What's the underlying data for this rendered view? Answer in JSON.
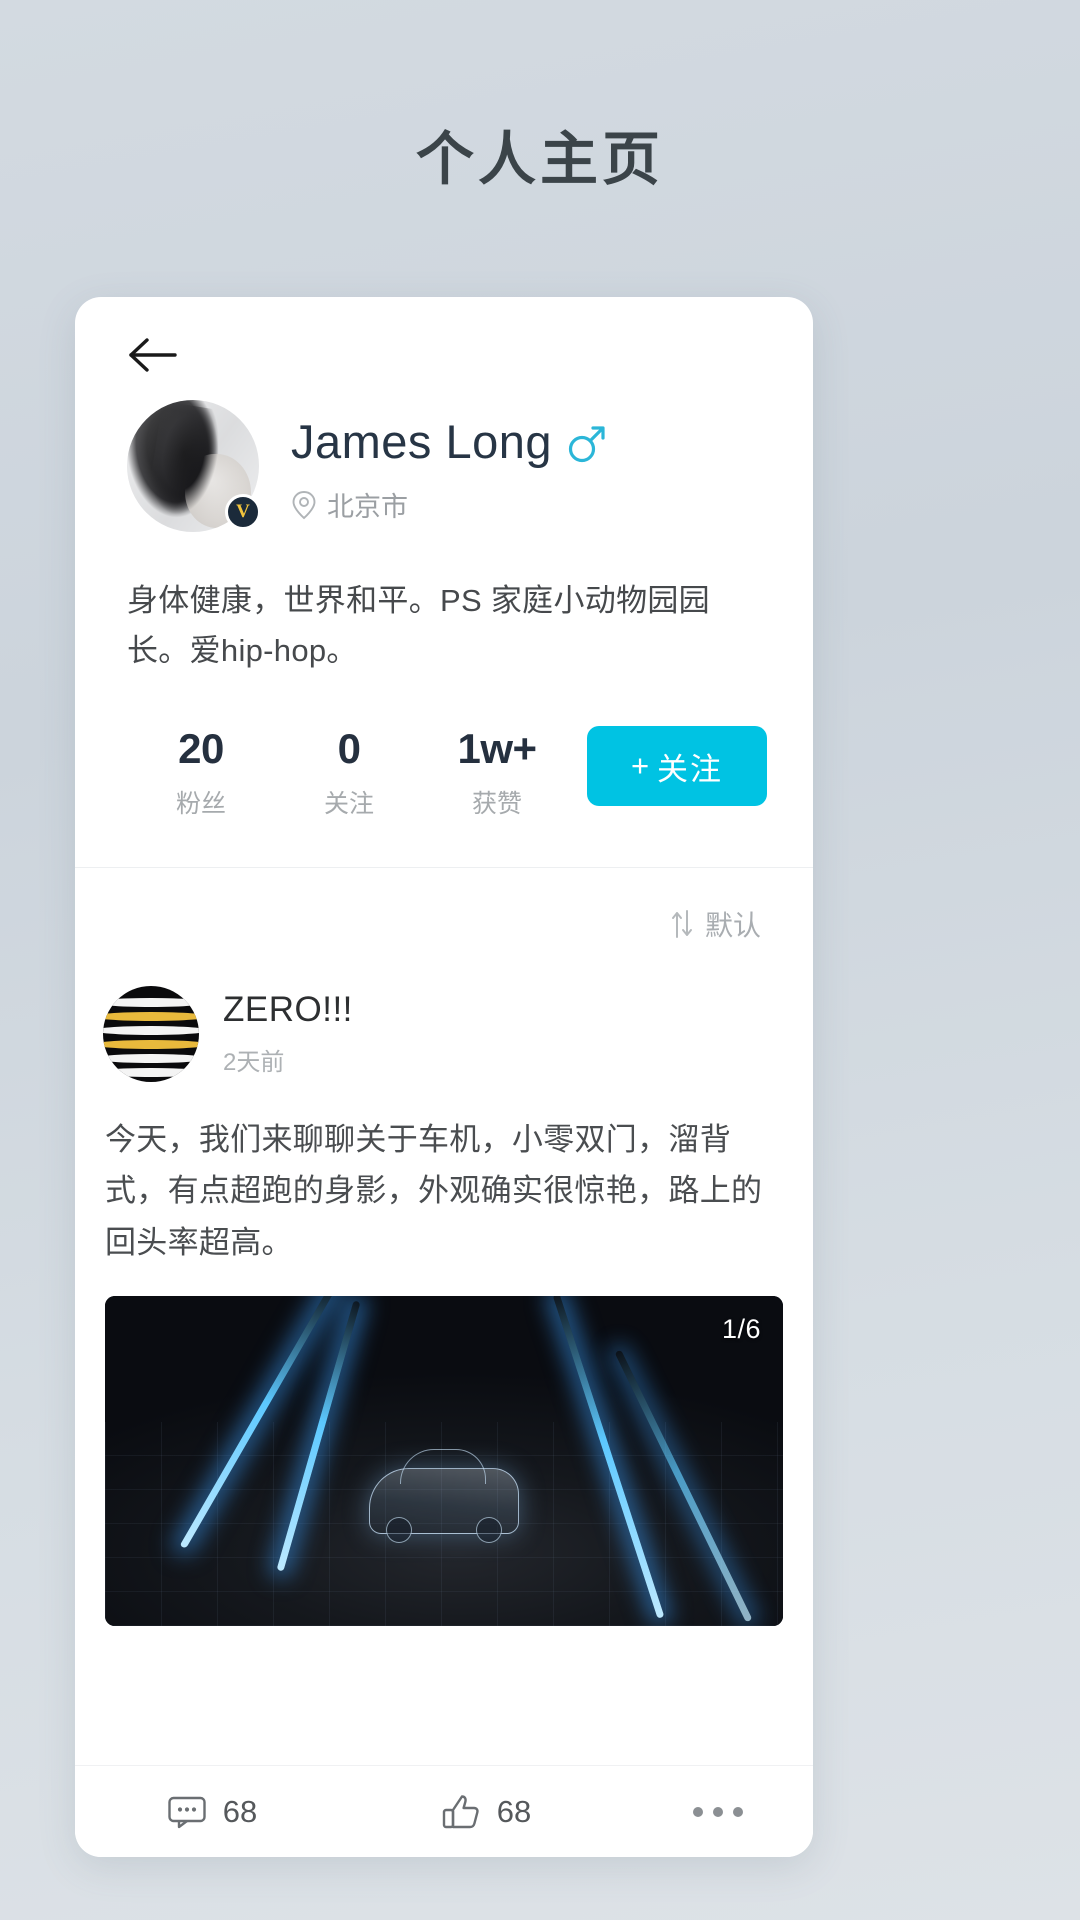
{
  "page": {
    "title": "个人主页",
    "accent_color": "#00c3e3",
    "background_color": "#d3dae1",
    "card_color": "#ffffff"
  },
  "navigation": {
    "back_icon": "arrow-left-icon"
  },
  "profile": {
    "avatar_alt": "avatar",
    "verified_badge": "V",
    "display_name": "James Long",
    "gender_icon": "male-symbol-icon",
    "gender": "male",
    "location_icon": "location-pin-icon",
    "location": "北京市",
    "bio": "身体健康，世界和平。PS 家庭小动物园园长。爱hip-hop。",
    "stats": [
      {
        "value": "20",
        "label": "粉丝"
      },
      {
        "value": "0",
        "label": "关注"
      },
      {
        "value": "1w+",
        "label": "获赞"
      }
    ],
    "follow_button": {
      "plus": "+",
      "label": "关注"
    }
  },
  "feed": {
    "sort": {
      "icon": "sort-updown-icon",
      "label": "默认"
    },
    "post": {
      "author": "ZERO!!!",
      "time": "2天前",
      "body": "今天，我们来聊聊关于车机，小零双门，溜背式，有点超跑的身影，外观确实很惊艳，路上的回头率超高。",
      "media": {
        "counter": "1/6",
        "alt": "concept car on glowing light trail road"
      },
      "actions": {
        "comment_icon": "comment-icon",
        "comment_count": "68",
        "like_icon": "thumbs-up-icon",
        "like_count": "68",
        "more_icon": "more-horizontal-icon"
      }
    }
  }
}
